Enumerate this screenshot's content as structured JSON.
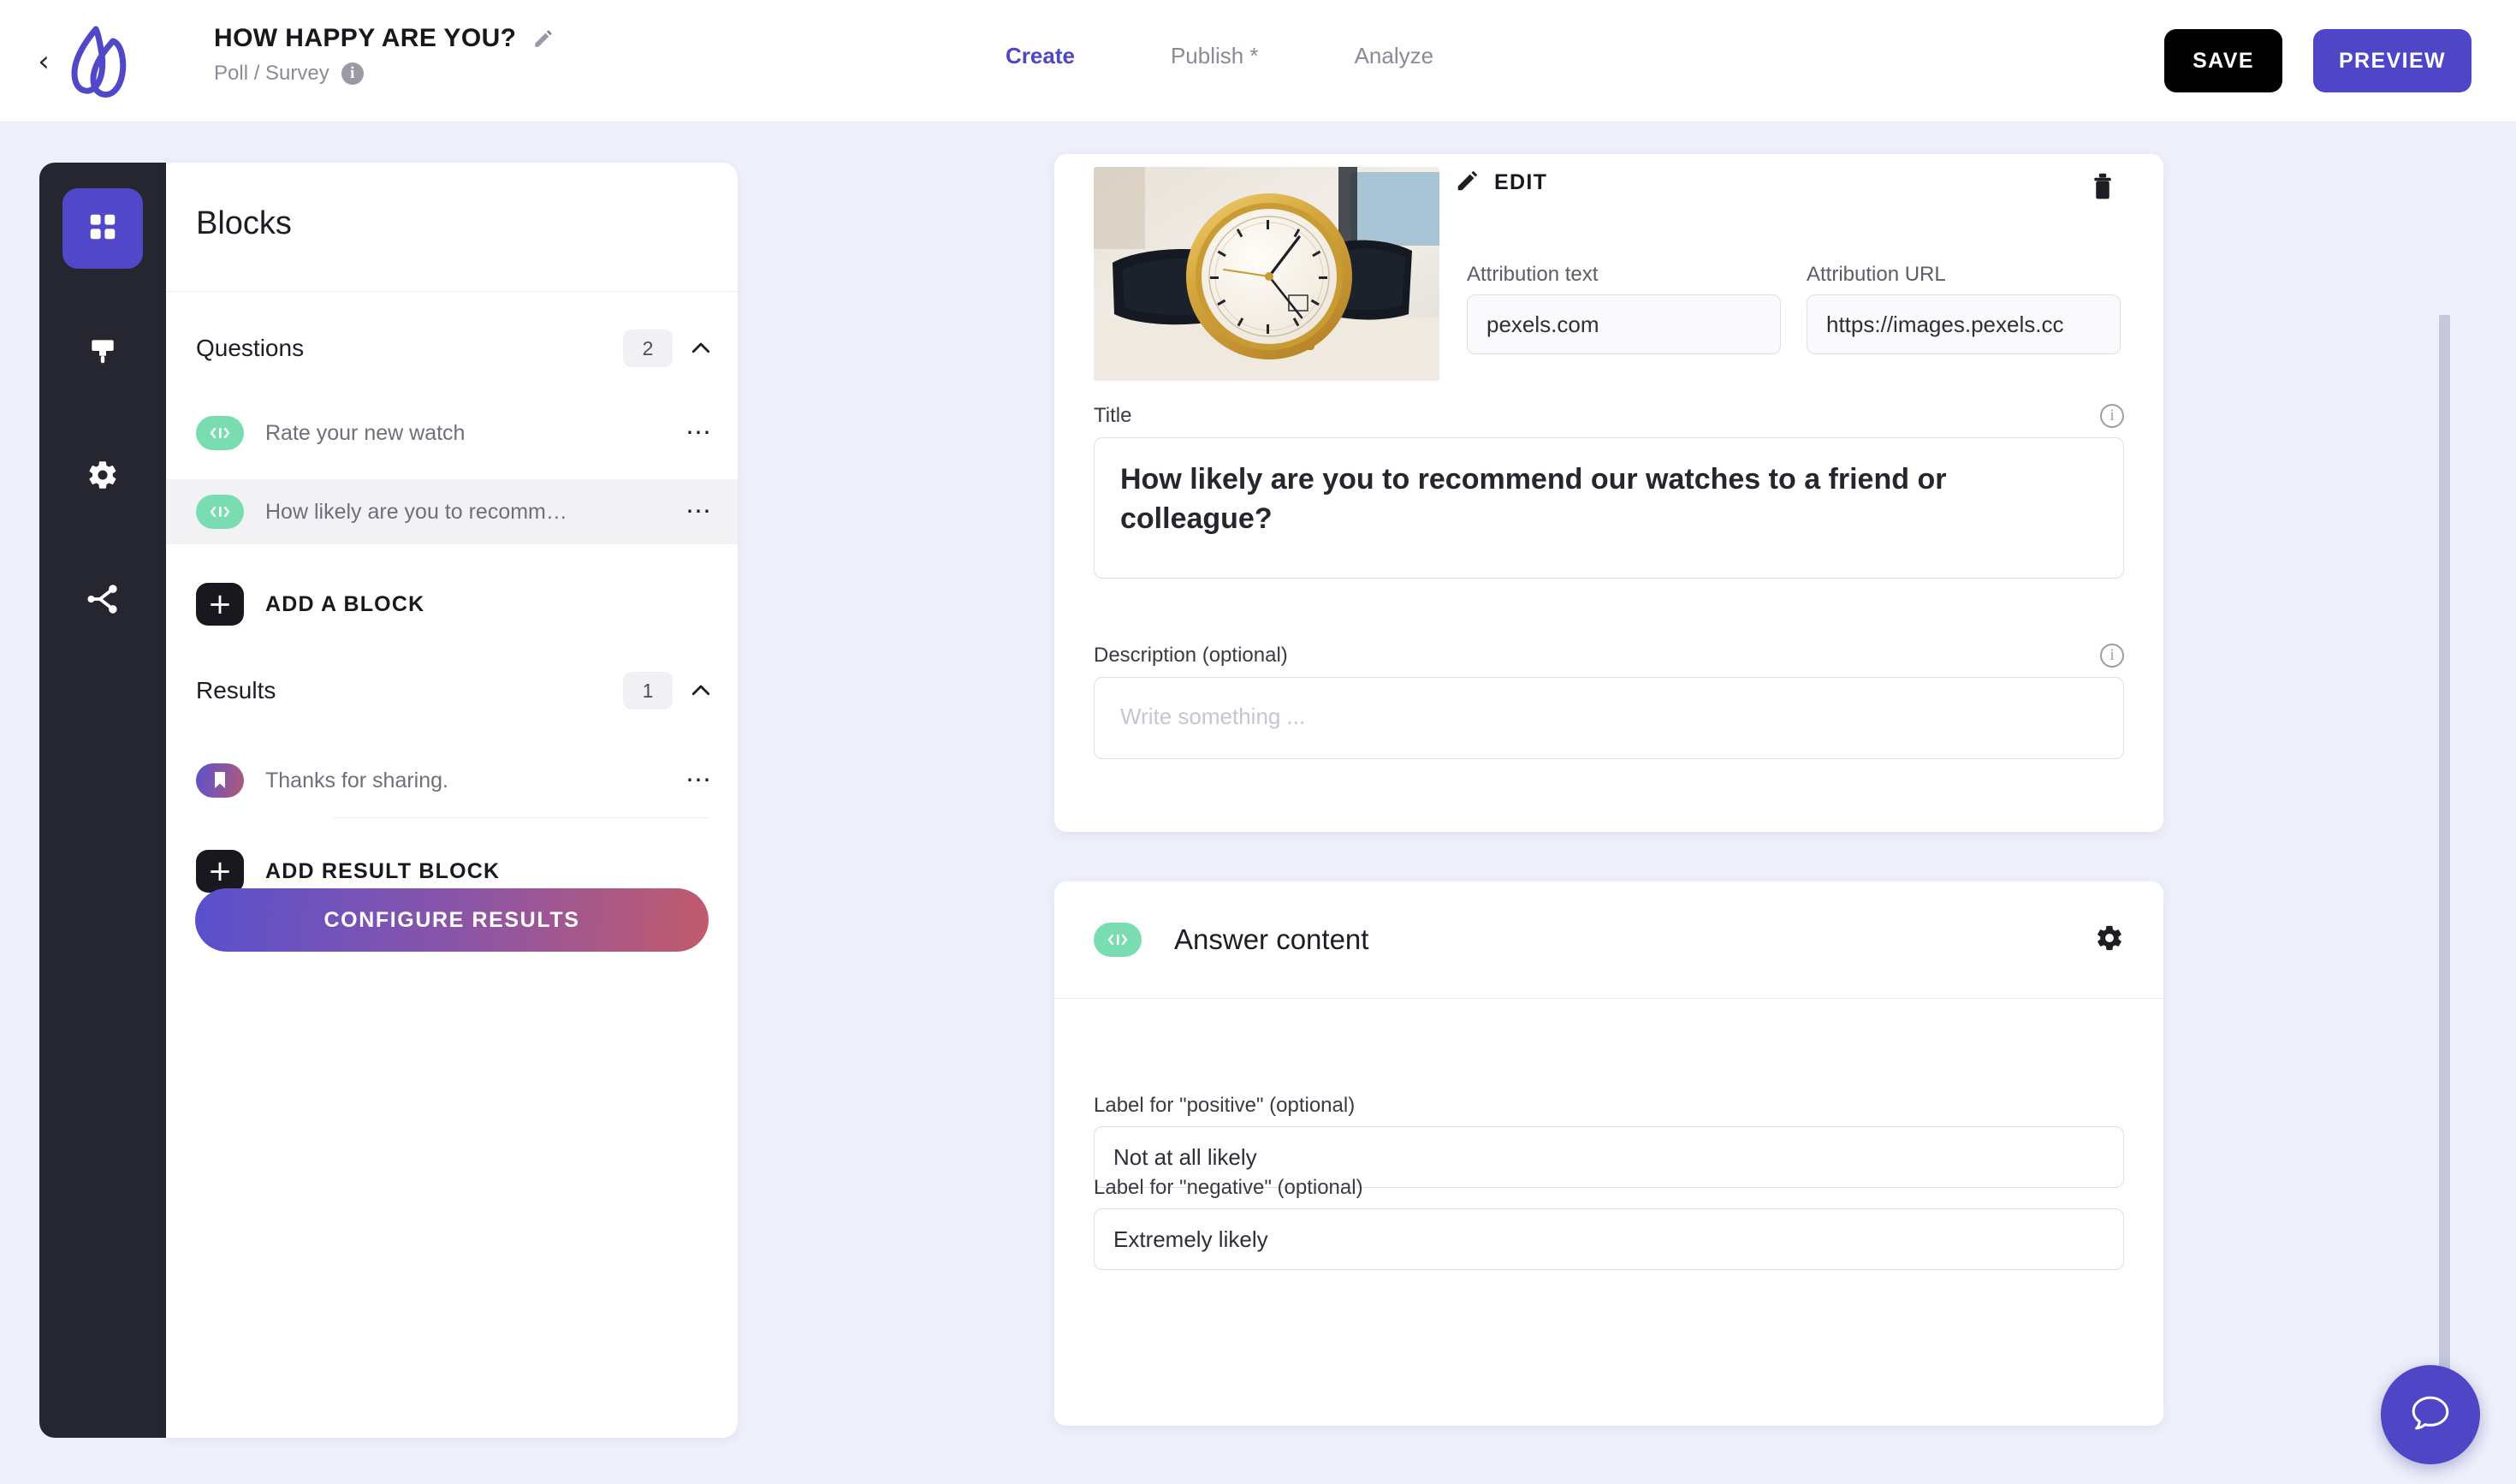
{
  "header": {
    "back_icon": "chevron-left-icon",
    "logo_icon": "brand-logo-icon",
    "doc_title": "HOW HAPPY ARE YOU?",
    "edit_title_icon": "pencil-icon",
    "doc_type": "Poll / Survey",
    "info_icon": "info-icon",
    "nav": [
      {
        "label": "Create",
        "active": true
      },
      {
        "label": "Publish *",
        "active": false
      },
      {
        "label": "Analyze",
        "active": false
      }
    ],
    "save_label": "SAVE",
    "preview_label": "PREVIEW",
    "accent_color": "#4f46c7",
    "save_color": "#000000"
  },
  "rail": {
    "items": [
      {
        "icon": "grid-blocks-icon",
        "active": true
      },
      {
        "icon": "paintbrush-icon",
        "active": false
      },
      {
        "icon": "gear-icon",
        "active": false
      },
      {
        "icon": "share-branch-icon",
        "active": false
      }
    ]
  },
  "panel": {
    "title": "Blocks",
    "questions": {
      "label": "Questions",
      "count": "2",
      "collapse_icon": "chevron-up-icon",
      "items": [
        {
          "label": "Rate your new watch",
          "icon": "slider-range-icon",
          "selected": false,
          "menu_icon": "more-dots-icon"
        },
        {
          "label": "How likely are you to recomm…",
          "icon": "slider-range-icon",
          "selected": true,
          "menu_icon": "more-dots-icon"
        }
      ],
      "add_label": "ADD A BLOCK",
      "add_icon": "plus-icon"
    },
    "results": {
      "label": "Results",
      "count": "1",
      "collapse_icon": "chevron-up-icon",
      "items": [
        {
          "label": "Thanks for sharing.",
          "icon": "bookmark-icon",
          "menu_icon": "more-dots-icon"
        }
      ],
      "add_label": "ADD RESULT BLOCK",
      "add_icon": "plus-icon"
    },
    "configure_label": "CONFIGURE RESULTS"
  },
  "question_card": {
    "image_alt": "gold-watch-photo",
    "edit_label": "EDIT",
    "edit_icon": "pencil-icon",
    "delete_icon": "trash-icon",
    "attribution_text_label": "Attribution text",
    "attribution_text_value": "pexels.com",
    "attribution_text_placeholder": "pexels.com",
    "attribution_url_label": "Attribution URL",
    "attribution_url_value": "https://images.pexels.cc",
    "attribution_url_placeholder": "https://images.pexels.co",
    "title_label": "Title",
    "title_info_icon": "info-icon",
    "title_value": "How likely are you to recommend our watches to a friend or colleague?",
    "description_label": "Description (optional)",
    "description_info_icon": "info-icon",
    "description_value": "",
    "description_placeholder": "Write something ..."
  },
  "answer_card": {
    "badge_icon": "slider-range-icon",
    "title": "Answer content",
    "settings_icon": "gear-icon",
    "positive_label": "Label for \"positive\" (optional)",
    "positive_value": "Not at all likely",
    "positive_placeholder": "Not at all likely",
    "negative_label": "Label for \"negative\" (optional)",
    "negative_value": "Extremely likely",
    "negative_placeholder": "Extremely likely"
  },
  "chat": {
    "icon": "chat-bubble-icon"
  },
  "scrollbar": {
    "name": "vertical-scrollbar"
  }
}
